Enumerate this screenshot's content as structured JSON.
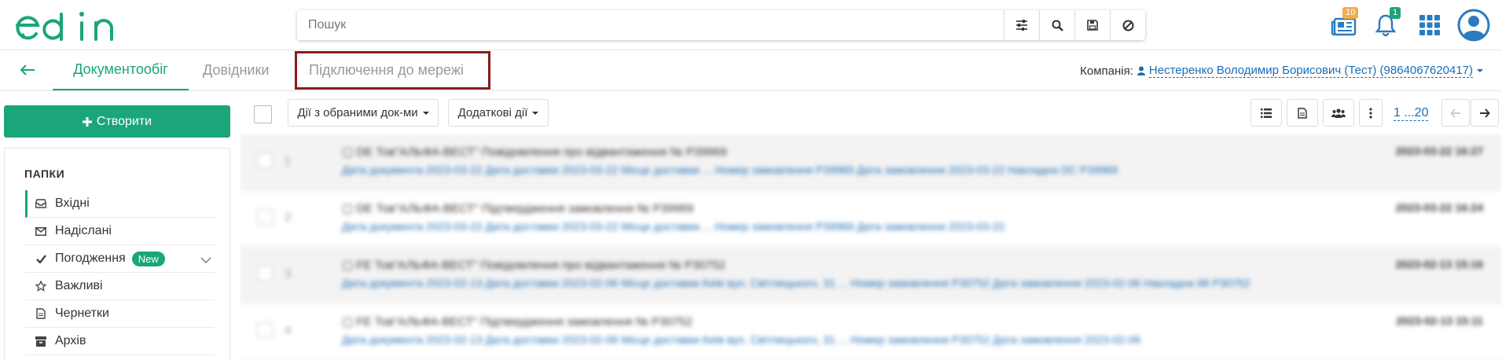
{
  "header": {
    "logo_alt": "edin",
    "search_placeholder": "Пошук",
    "news_badge": "10",
    "notifications_badge": "1"
  },
  "tabs": {
    "documents": "Документообіг",
    "directories": "Довідники",
    "network": "Підключення до мережі"
  },
  "company": {
    "label": "Компанія:",
    "name": "Нестеренко Володимир Борисович (Тест) (9864067620417)"
  },
  "sidebar": {
    "create_label": "Створити",
    "folders_title": "ПАПКИ",
    "folders": [
      {
        "label": "Вхідні",
        "icon": "inbox-icon"
      },
      {
        "label": "Надіслані",
        "icon": "envelope-icon"
      },
      {
        "label": "Погодження",
        "icon": "check-icon",
        "badge": "New"
      },
      {
        "label": "Важливі",
        "icon": "star-icon"
      },
      {
        "label": "Чернетки",
        "icon": "document-icon"
      },
      {
        "label": "Архів",
        "icon": "archive-icon"
      }
    ]
  },
  "toolbar": {
    "bulk_actions": "Дії з обраними док-ми",
    "extra_actions": "Додаткові дії",
    "pager": "1 ...20"
  },
  "documents": [
    {
      "num": "1",
      "title": "▢ DE Тов\"АЛЬФА-ВЕСТ\" Повідомлення про відвантаження № P39969",
      "meta": "Дата документа 2023-03-22 Дата доставки 2023-03-22 Місце доставки ... Номер замовлення P39969 Дата замовлення 2023-03-22 Накладна DC P39969",
      "date": "2023-03-22 16:27"
    },
    {
      "num": "2",
      "title": "▢ DE Тов\"АЛЬФА-ВЕСТ\" Підтвердження замовлення № P39969",
      "meta": "Дата документа 2023-03-22 Дата доставки 2023-03-22 Місце доставки ... Номер замовлення P39969 Дата замовлення 2023-03-22",
      "date": "2023-03-22 16:24"
    },
    {
      "num": "3",
      "title": "▢ FE Тов\"АЛЬФА-ВЕСТ\" Повідомлення про відвантаження № P30752",
      "meta": "Дата документа 2023-02-13 Дата доставки 2023-02-06 Місце доставки Київ вул. Світлицького, 31 ... Номер замовлення P30752 Дата замовлення 2023-02-06 Накладна 98 P30752",
      "date": "2023-02-13 15:16"
    },
    {
      "num": "4",
      "title": "▢ FE Тов\"АЛЬФА-ВЕСТ\" Підтвердження замовлення № P30752",
      "meta": "Дата документа 2023-02-13 Дата доставки 2023-02-06 Місце доставки Київ вул. Світлицького, 31 ... Номер замовлення P30752 Дата замовлення 2023-02-06",
      "date": "2023-02-13 15:11"
    }
  ]
}
